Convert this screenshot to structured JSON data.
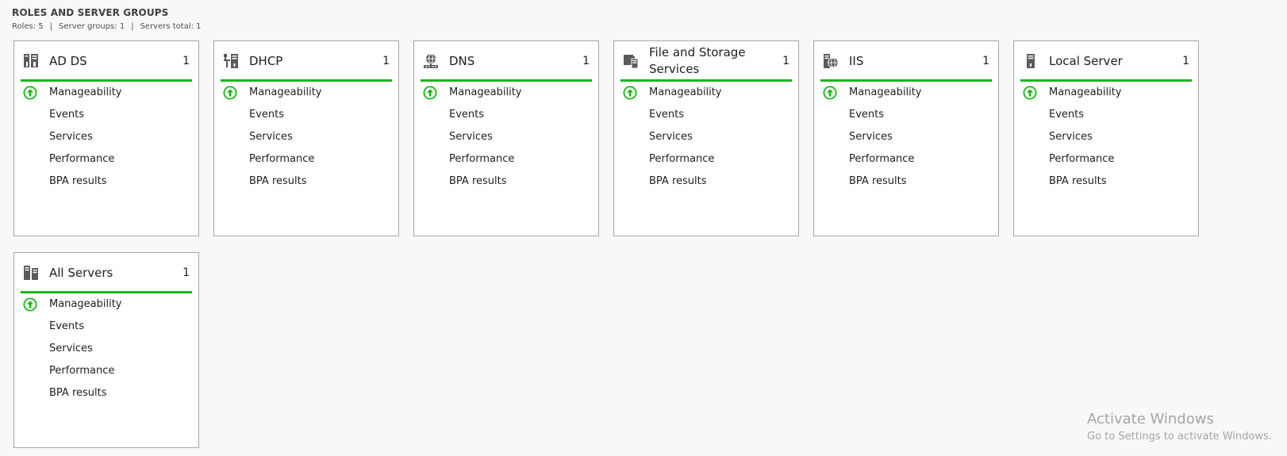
{
  "section": {
    "title": "ROLES AND SERVER GROUPS",
    "summary": {
      "roles": "Roles: 5",
      "server_groups": "Server groups: 1",
      "servers_total": "Servers total: 1",
      "separator": "|"
    }
  },
  "tiles": [
    {
      "name": "AD DS",
      "count": "1",
      "icon": "ad-ds-icon",
      "items": [
        "Manageability",
        "Events",
        "Services",
        "Performance",
        "BPA results"
      ],
      "status": "ok"
    },
    {
      "name": "DHCP",
      "count": "1",
      "icon": "dhcp-icon",
      "items": [
        "Manageability",
        "Events",
        "Services",
        "Performance",
        "BPA results"
      ],
      "status": "ok"
    },
    {
      "name": "DNS",
      "count": "1",
      "icon": "dns-icon",
      "items": [
        "Manageability",
        "Events",
        "Services",
        "Performance",
        "BPA results"
      ],
      "status": "ok"
    },
    {
      "name": "File and Storage Services",
      "count": "1",
      "icon": "file-storage-icon",
      "items": [
        "Manageability",
        "Events",
        "Services",
        "Performance",
        "BPA results"
      ],
      "status": "ok"
    },
    {
      "name": "IIS",
      "count": "1",
      "icon": "iis-icon",
      "items": [
        "Manageability",
        "Events",
        "Services",
        "Performance",
        "BPA results"
      ],
      "status": "ok"
    },
    {
      "name": "Local Server",
      "count": "1",
      "icon": "local-server-icon",
      "items": [
        "Manageability",
        "Events",
        "Services",
        "Performance",
        "BPA results"
      ],
      "status": "ok"
    },
    {
      "name": "All Servers",
      "count": "1",
      "icon": "all-servers-icon",
      "items": [
        "Manageability",
        "Events",
        "Services",
        "Performance",
        "BPA results"
      ],
      "status": "ok"
    }
  ],
  "colors": {
    "status_ok": "#1ab61a",
    "icon_gray": "#5a5a5a"
  },
  "watermark": {
    "title": "Activate Windows",
    "subtitle": "Go to Settings to activate Windows."
  }
}
